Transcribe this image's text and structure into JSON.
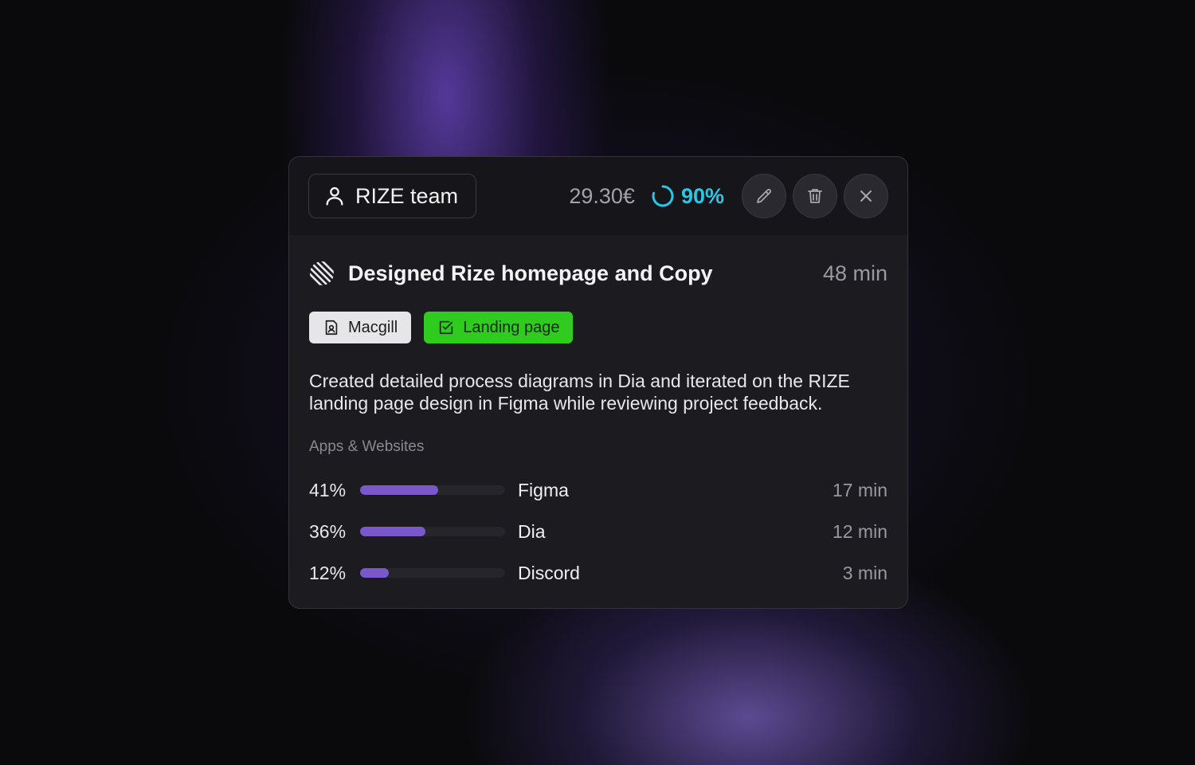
{
  "header": {
    "team_label": "RIZE team",
    "price": "29.30€",
    "score": "90%",
    "score_color": "#29c7e6",
    "icons": [
      "user-icon",
      "progress-ring-icon",
      "pencil-icon",
      "trash-icon",
      "close-icon"
    ]
  },
  "session": {
    "title": "Designed Rize homepage and Copy",
    "duration": "48 min",
    "tags": [
      {
        "label": "Macgill",
        "icon": "client-icon",
        "color": "#e6e6e9"
      },
      {
        "label": "Landing page",
        "icon": "checkbox-icon",
        "color": "#2fcc1f"
      }
    ],
    "description": "Created detailed process diagrams in Dia and iterated on the RIZE landing page design in Figma while reviewing project feedback."
  },
  "apps_section": {
    "label": "Apps & Websites",
    "bar_color": "#7a58cc",
    "items": [
      {
        "percent_label": "41%",
        "share": 0.54,
        "name": "Figma",
        "time": "17 min"
      },
      {
        "percent_label": "36%",
        "share": 0.45,
        "name": "Dia",
        "time": "12 min"
      },
      {
        "percent_label": "12%",
        "share": 0.2,
        "name": "Discord",
        "time": "3 min"
      }
    ]
  }
}
